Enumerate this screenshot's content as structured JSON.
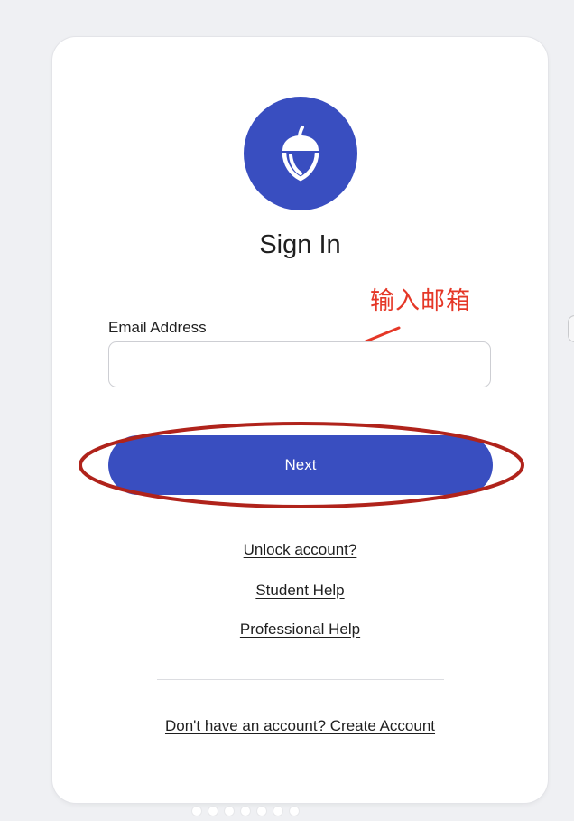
{
  "brand_color": "#394ec0",
  "annotation_color": "#e53727",
  "logo": {
    "icon": "acorn-icon"
  },
  "title": "Sign In",
  "annotation": {
    "text": "输入邮箱"
  },
  "email": {
    "label": "Email Address",
    "value": "",
    "placeholder": ""
  },
  "next_button": {
    "label": "Next"
  },
  "links": {
    "unlock": "Unlock account?",
    "student_help": "Student Help",
    "professional_help": "Professional Help",
    "create_account": "Don't have an account? Create Account"
  }
}
